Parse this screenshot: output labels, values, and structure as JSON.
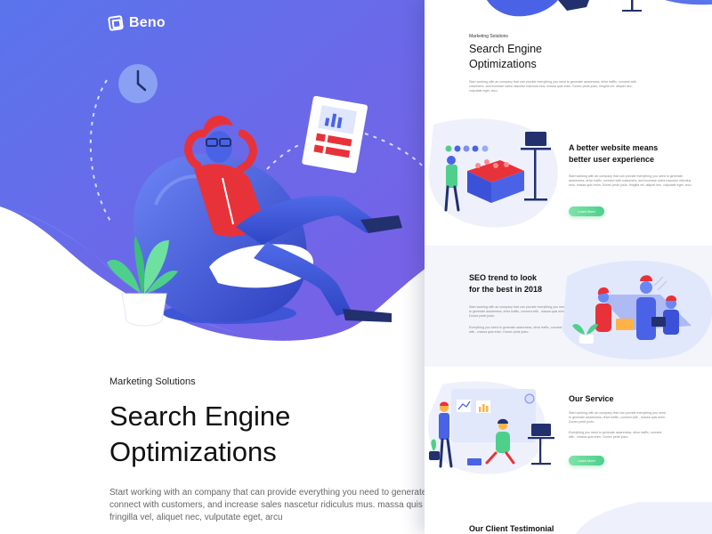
{
  "brand": {
    "name": "Beno"
  },
  "hero": {
    "kicker": "Marketing Solutions",
    "title_line1": "Search Engine",
    "title_line2": "Optimizations",
    "body": "Start working with an company that can provide everything you need to generate awareness, drive traffic, connect with customers, and increase sales nascetur ridiculus mus. massa quis enim. Donec pede justo, fringilla vel, aliquet nec, vulputate eget, arcu"
  },
  "preview": {
    "seo": {
      "kicker": "Marketing Solutions",
      "title_line1": "Search Engine",
      "title_line2": "Optimizations",
      "body": "Start working with an company that can provide everything you need to generate awareness, drive traffic, connect with customers, and increase sales nascetur ridiculus mus. massa quis enim. Donec pede justo, fringilla vel, aliquet nec, vulputate eget, arcu"
    },
    "website": {
      "title_line1": "A better website means",
      "title_line2": "better user experience",
      "body": "Start working with an company that can provide everything you need to generate awareness, drive traffic, connect with customers, and increase sales nascetur ridiculus mus. massa quis enim. Donec pede justo, fringilla vel, aliquet nec, vulputate eget, arcu",
      "button": "Learn More"
    },
    "trend": {
      "title_line1": "SEO trend to look",
      "title_line2": "for the best in 2018",
      "body1": "Start working with an company that can provide everything you need to generate awareness, drive traffic, connect with , massa quis enim. Donec pede justo.",
      "body2": "Everything you need to generate awareness, drive traffic, connect with , massa quis enim. Donec pede justo."
    },
    "service": {
      "title": "Our Service",
      "body1": "Start working with an company that can provide everything you need to generate awareness, drive traffic, connect with , massa quis enim. Donec pede justo.",
      "body2": "Everything you need to generate awareness, drive traffic, connect with , massa quis enim. Donec pede justo.",
      "button": "Learn More"
    },
    "testimonial": {
      "title": "Our Client Testimonial"
    }
  },
  "colors": {
    "accent": "#4a63e6",
    "accent_light": "#7b8ff0",
    "red": "#e8323a",
    "green": "#4fcf8c",
    "navy": "#22306e"
  }
}
